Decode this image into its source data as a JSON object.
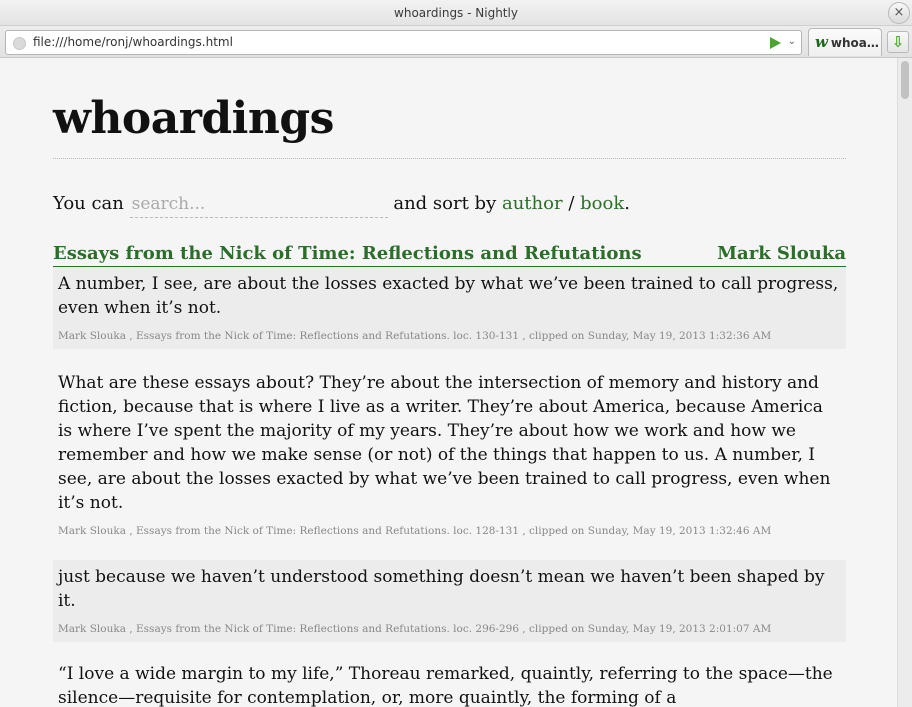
{
  "window": {
    "title": "whoardings - Nightly",
    "close_label": "×"
  },
  "navbar": {
    "url": "file:///home/ronj/whoardings.html",
    "dropdown_glyph": "⌄",
    "tab_favicon": "w",
    "tab_label": "whoa…",
    "download_glyph": "⇩"
  },
  "page": {
    "title": "whoardings",
    "intro_prefix": "You can",
    "search_placeholder": "search...",
    "intro_middle": "and sort by",
    "sort_author": "author",
    "sort_separator": "/",
    "sort_book": "book",
    "intro_suffix": "."
  },
  "book": {
    "title": "Essays from the Nick of Time: Reflections and Refutations",
    "author": "Mark Slouka"
  },
  "clippings": [
    {
      "text": "A number, I see, are about the losses exacted by what we’ve been trained to call progress, even when it’s not.",
      "meta": "Mark Slouka , Essays from the Nick of Time: Reflections and Refutations. loc. 130-131 , clipped on Sunday, May 19, 2013 1:32:36 AM"
    },
    {
      "text": "What are these essays about? They’re about the intersection of memory and history and fiction, because that is where I live as a writer. They’re about America, because America is where I’ve spent the majority of my years. They’re about how we work and how we remember and how we make sense (or not) of the things that happen to us. A number, I see, are about the losses exacted by what we’ve been trained to call progress, even when it’s not.",
      "meta": "Mark Slouka , Essays from the Nick of Time: Reflections and Refutations. loc. 128-131 , clipped on Sunday, May 19, 2013 1:32:46 AM"
    },
    {
      "text": "just because we haven’t understood something doesn’t mean we haven’t been shaped by it.",
      "meta": "Mark Slouka , Essays from the Nick of Time: Reflections and Refutations. loc. 296-296 , clipped on Sunday, May 19, 2013 2:01:07 AM"
    },
    {
      "text": "“I love a wide margin to my life,” Thoreau remarked, quaintly, referring to the space—the silence—requisite for contemplation, or, more quaintly, the forming of a",
      "meta": ""
    }
  ]
}
